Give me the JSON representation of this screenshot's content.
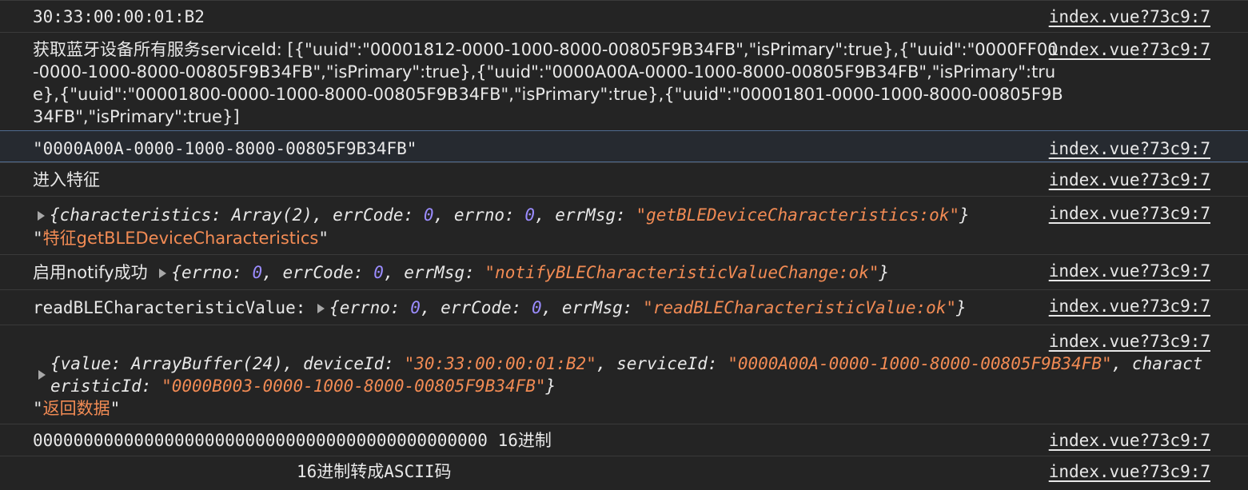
{
  "source_link": "index.vue?73c9:7",
  "rows": [
    {
      "text": "30:33:00:00:01:B2"
    },
    {
      "text": "获取蓝牙设备所有服务serviceId: [{\"uuid\":\"00001812-0000-1000-8000-00805F9B34FB\",\"isPrimary\":true},{\"uuid\":\"0000FF00-0000-1000-8000-00805F9B34FB\",\"isPrimary\":true},{\"uuid\":\"0000A00A-0000-1000-8000-00805F9B34FB\",\"isPrimary\":true},{\"uuid\":\"00001800-0000-1000-8000-00805F9B34FB\",\"isPrimary\":true},{\"uuid\":\"00001801-0000-1000-8000-00805F9B34FB\",\"isPrimary\":true}]"
    },
    {
      "text": "\"0000A00A-0000-1000-8000-00805F9B34FB\""
    },
    {
      "text": "进入特征"
    },
    {
      "obj_open": "{",
      "k1": "characteristics:",
      "v1": "Array(2)",
      "k2": "errCode:",
      "v2": "0",
      "k3": "errno:",
      "v3": "0",
      "k4": "errMsg:",
      "v4": "\"getBLEDeviceCharacteristics:ok\"",
      "obj_close": "}",
      "quote": "\"",
      "label": "特征getBLEDeviceCharacteristics"
    },
    {
      "prefix": "启用notify成功",
      "k1": "errno:",
      "v1": "0",
      "k2": "errCode:",
      "v2": "0",
      "k3": "errMsg:",
      "v3": "\"notifyBLECharacteristicValueChange:ok\""
    },
    {
      "prefix": "readBLECharacteristicValue:",
      "k1": "errno:",
      "v1": "0",
      "k2": "errCode:",
      "v2": "0",
      "k3": "errMsg:",
      "v3": "\"readBLECharacteristicValue:ok\""
    },
    {
      "k1": "value:",
      "v1": "ArrayBuffer(24)",
      "k2": "deviceId:",
      "v2": "\"30:33:00:00:01:B2\"",
      "k3": "serviceId:",
      "v3": "\"0000A00A-0000-1000-8000-00805F9B34FB\"",
      "k4": "characteristicId:",
      "v4": "\"0000B003-0000-1000-8000-00805F9B34FB\"",
      "quote": "\"",
      "label": "返回数据"
    },
    {
      "text": "000000000000000000000000000000000000000000000 16进制"
    },
    {
      "text": "16进制转成ASCII码"
    }
  ]
}
